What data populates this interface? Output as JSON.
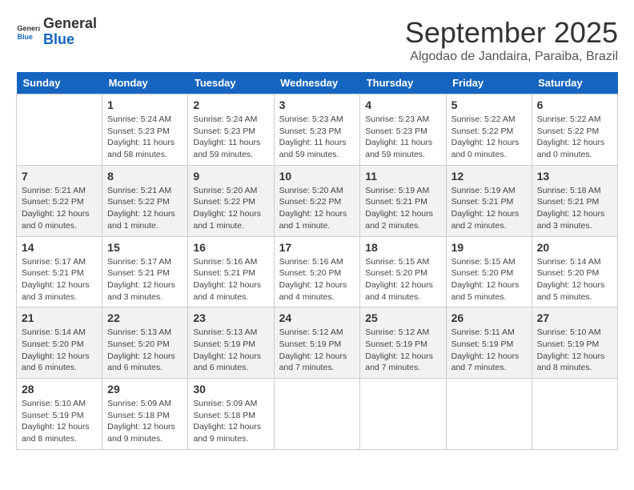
{
  "logo": {
    "general": "General",
    "blue": "Blue"
  },
  "title": {
    "month": "September 2025",
    "location": "Algodao de Jandaira, Paraiba, Brazil"
  },
  "days_of_week": [
    "Sunday",
    "Monday",
    "Tuesday",
    "Wednesday",
    "Thursday",
    "Friday",
    "Saturday"
  ],
  "weeks": [
    [
      {
        "day": "",
        "info": ""
      },
      {
        "day": "1",
        "info": "Sunrise: 5:24 AM\nSunset: 5:23 PM\nDaylight: 11 hours\nand 58 minutes."
      },
      {
        "day": "2",
        "info": "Sunrise: 5:24 AM\nSunset: 5:23 PM\nDaylight: 11 hours\nand 59 minutes."
      },
      {
        "day": "3",
        "info": "Sunrise: 5:23 AM\nSunset: 5:23 PM\nDaylight: 11 hours\nand 59 minutes."
      },
      {
        "day": "4",
        "info": "Sunrise: 5:23 AM\nSunset: 5:23 PM\nDaylight: 11 hours\nand 59 minutes."
      },
      {
        "day": "5",
        "info": "Sunrise: 5:22 AM\nSunset: 5:22 PM\nDaylight: 12 hours\nand 0 minutes."
      },
      {
        "day": "6",
        "info": "Sunrise: 5:22 AM\nSunset: 5:22 PM\nDaylight: 12 hours\nand 0 minutes."
      }
    ],
    [
      {
        "day": "7",
        "info": "Sunrise: 5:21 AM\nSunset: 5:22 PM\nDaylight: 12 hours\nand 0 minutes."
      },
      {
        "day": "8",
        "info": "Sunrise: 5:21 AM\nSunset: 5:22 PM\nDaylight: 12 hours\nand 1 minute."
      },
      {
        "day": "9",
        "info": "Sunrise: 5:20 AM\nSunset: 5:22 PM\nDaylight: 12 hours\nand 1 minute."
      },
      {
        "day": "10",
        "info": "Sunrise: 5:20 AM\nSunset: 5:22 PM\nDaylight: 12 hours\nand 1 minute."
      },
      {
        "day": "11",
        "info": "Sunrise: 5:19 AM\nSunset: 5:21 PM\nDaylight: 12 hours\nand 2 minutes."
      },
      {
        "day": "12",
        "info": "Sunrise: 5:19 AM\nSunset: 5:21 PM\nDaylight: 12 hours\nand 2 minutes."
      },
      {
        "day": "13",
        "info": "Sunrise: 5:18 AM\nSunset: 5:21 PM\nDaylight: 12 hours\nand 3 minutes."
      }
    ],
    [
      {
        "day": "14",
        "info": "Sunrise: 5:17 AM\nSunset: 5:21 PM\nDaylight: 12 hours\nand 3 minutes."
      },
      {
        "day": "15",
        "info": "Sunrise: 5:17 AM\nSunset: 5:21 PM\nDaylight: 12 hours\nand 3 minutes."
      },
      {
        "day": "16",
        "info": "Sunrise: 5:16 AM\nSunset: 5:21 PM\nDaylight: 12 hours\nand 4 minutes."
      },
      {
        "day": "17",
        "info": "Sunrise: 5:16 AM\nSunset: 5:20 PM\nDaylight: 12 hours\nand 4 minutes."
      },
      {
        "day": "18",
        "info": "Sunrise: 5:15 AM\nSunset: 5:20 PM\nDaylight: 12 hours\nand 4 minutes."
      },
      {
        "day": "19",
        "info": "Sunrise: 5:15 AM\nSunset: 5:20 PM\nDaylight: 12 hours\nand 5 minutes."
      },
      {
        "day": "20",
        "info": "Sunrise: 5:14 AM\nSunset: 5:20 PM\nDaylight: 12 hours\nand 5 minutes."
      }
    ],
    [
      {
        "day": "21",
        "info": "Sunrise: 5:14 AM\nSunset: 5:20 PM\nDaylight: 12 hours\nand 6 minutes."
      },
      {
        "day": "22",
        "info": "Sunrise: 5:13 AM\nSunset: 5:20 PM\nDaylight: 12 hours\nand 6 minutes."
      },
      {
        "day": "23",
        "info": "Sunrise: 5:13 AM\nSunset: 5:19 PM\nDaylight: 12 hours\nand 6 minutes."
      },
      {
        "day": "24",
        "info": "Sunrise: 5:12 AM\nSunset: 5:19 PM\nDaylight: 12 hours\nand 7 minutes."
      },
      {
        "day": "25",
        "info": "Sunrise: 5:12 AM\nSunset: 5:19 PM\nDaylight: 12 hours\nand 7 minutes."
      },
      {
        "day": "26",
        "info": "Sunrise: 5:11 AM\nSunset: 5:19 PM\nDaylight: 12 hours\nand 7 minutes."
      },
      {
        "day": "27",
        "info": "Sunrise: 5:10 AM\nSunset: 5:19 PM\nDaylight: 12 hours\nand 8 minutes."
      }
    ],
    [
      {
        "day": "28",
        "info": "Sunrise: 5:10 AM\nSunset: 5:19 PM\nDaylight: 12 hours\nand 8 minutes."
      },
      {
        "day": "29",
        "info": "Sunrise: 5:09 AM\nSunset: 5:18 PM\nDaylight: 12 hours\nand 9 minutes."
      },
      {
        "day": "30",
        "info": "Sunrise: 5:09 AM\nSunset: 5:18 PM\nDaylight: 12 hours\nand 9 minutes."
      },
      {
        "day": "",
        "info": ""
      },
      {
        "day": "",
        "info": ""
      },
      {
        "day": "",
        "info": ""
      },
      {
        "day": "",
        "info": ""
      }
    ]
  ]
}
